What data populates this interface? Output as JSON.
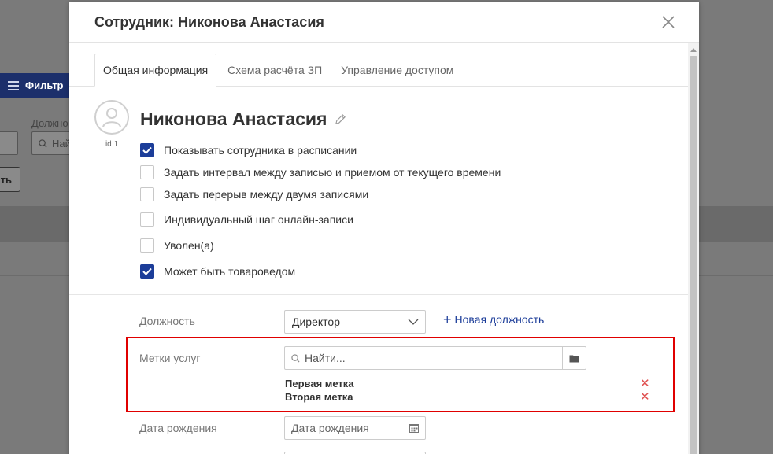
{
  "background": {
    "filter_label": "Фильтр",
    "position_label": "Должно",
    "search_partial": "Най",
    "button_partial": "ть"
  },
  "modal": {
    "title": "Сотрудник: Никонова Анастасия",
    "tabs": [
      {
        "label": "Общая информация"
      },
      {
        "label": "Схема расчёта ЗП"
      },
      {
        "label": "Управление доступом"
      }
    ],
    "employee": {
      "name": "Никонова Анастасия",
      "id_label": "id 1"
    },
    "checkboxes": [
      {
        "label": "Показывать сотрудника в расписании",
        "checked": true
      },
      {
        "label": "Задать интервал между записью и приемом от текущего времени",
        "checked": false
      },
      {
        "label": "Задать перерыв между двумя записями",
        "checked": false
      },
      {
        "label": "Индивидуальный шаг онлайн-записи",
        "checked": false
      },
      {
        "label": "Уволен(а)",
        "checked": false
      },
      {
        "label": "Может быть товароведом",
        "checked": true
      }
    ],
    "position": {
      "label": "Должность",
      "value": "Директор",
      "new_link": "Новая должность"
    },
    "service_tags": {
      "label": "Метки услуг",
      "search_placeholder": "Найти...",
      "items": [
        "Первая метка",
        "Вторая метка"
      ],
      "remove_glyph": "✕"
    },
    "birth_date": {
      "label": "Дата рождения",
      "placeholder": "Дата рождения"
    }
  },
  "colors": {
    "accent": "#1c3d99",
    "highlight": "#e00000",
    "remove": "#e05050"
  }
}
